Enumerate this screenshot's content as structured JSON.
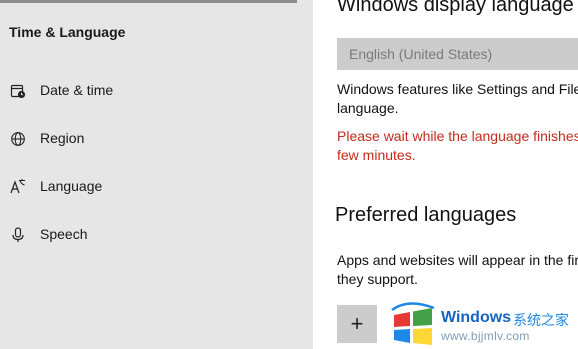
{
  "sidebar": {
    "section_title": "Time & Language",
    "items": [
      {
        "label": "Date & time",
        "icon": "calendar-clock-icon"
      },
      {
        "label": "Region",
        "icon": "globe-icon"
      },
      {
        "label": "Language",
        "icon": "language-icon"
      },
      {
        "label": "Speech",
        "icon": "microphone-icon"
      }
    ]
  },
  "main": {
    "display_language": {
      "heading": "Windows display language",
      "selected": "English (United States)",
      "description_line1": "Windows features like Settings and File",
      "description_line2": "language.",
      "warning_line1": "Please wait while the language finishes",
      "warning_line2": "few minutes."
    },
    "preferred_languages": {
      "heading": "Preferred languages",
      "description_line1": "Apps and websites will appear in the fir",
      "description_line2": "they support.",
      "add_button_label": "+"
    }
  },
  "watermark": {
    "brand": "Windows",
    "brand_cn": "系统之家",
    "url": "www.bjjmlv.com"
  },
  "colors": {
    "sidebar_bg": "#e6e6e6",
    "warning": "#c42b1c",
    "watermark_blue": "#1565c0"
  }
}
